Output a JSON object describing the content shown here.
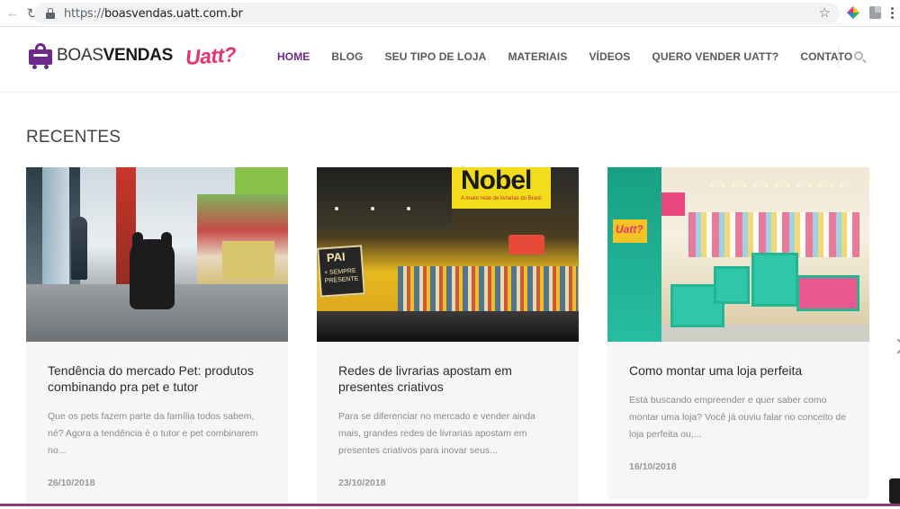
{
  "browser": {
    "url_scheme": "https://",
    "url_host": "boasvendas.uatt.com.br",
    "back_icon": "back-arrow-icon",
    "reload_icon": "reload-icon"
  },
  "header": {
    "logo_light": "BOAS",
    "logo_bold": "VENDAS",
    "logo_brand": "Uatt?",
    "nav": [
      {
        "label": "HOME",
        "active": true
      },
      {
        "label": "BLOG"
      },
      {
        "label": "SEU TIPO DE LOJA"
      },
      {
        "label": "MATERIAIS"
      },
      {
        "label": "VÍDEOS"
      },
      {
        "label": "QUERO VENDER UATT?"
      },
      {
        "label": "CONTATO"
      }
    ]
  },
  "content": {
    "section_title": "RECENTES",
    "cards": [
      {
        "title": "Tendência do mercado Pet: produtos combinando pra pet e tutor",
        "excerpt": "Que os pets fazem parte da família todos sabem, né? Agora a tendência é o tutor e pet combinarem no...",
        "date": "26/10/2018"
      },
      {
        "title": "Redes de livrarias apostam em presentes criativos",
        "excerpt": "Para se diferenciar no mercado e vender ainda mais, grandes redes de livrarias apostam em presentes criativos para inovar seus...",
        "date": "23/10/2018",
        "photo_sign": "Nobel",
        "photo_sign_small": "A maior rede de livrarias do Brasil",
        "photo_box_big": "PAI",
        "photo_box_small": "+ SEMPRE PRESENTE"
      },
      {
        "title": "Como montar uma loja perfeita",
        "excerpt": "Está buscando empreender e quer saber como montar uma loja? Você já ouviu falar no conceito de loja perfeita ou,...",
        "date": "16/10/2018",
        "photo_sign": "Uatt?"
      }
    ]
  },
  "colors": {
    "brand_purple": "#6c2b8c",
    "brand_pink": "#e8336f"
  }
}
